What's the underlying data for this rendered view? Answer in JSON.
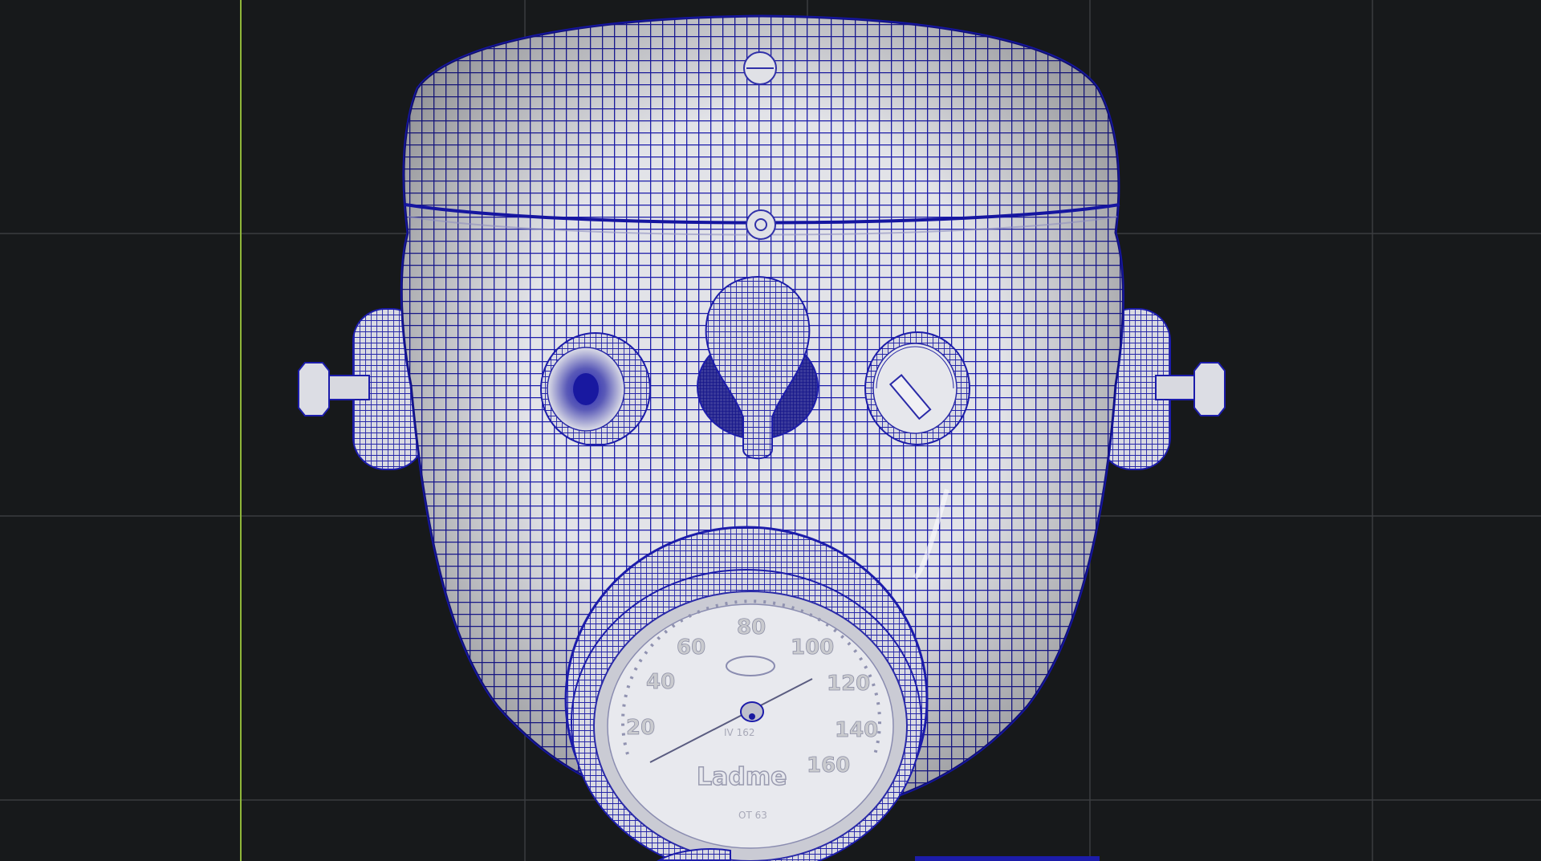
{
  "viewport": {
    "background": "#17191b",
    "grid_color": "#3a3c40",
    "axis_color": "#8fb63a",
    "wire_color": "#1a1aa8",
    "surface_color": "#e4e5ea"
  },
  "model": {
    "name": "robot-head-wireframe",
    "gauge": {
      "numbers": [
        "20",
        "40",
        "60",
        "80",
        "100",
        "120",
        "140",
        "160"
      ],
      "brand": "Ladme",
      "small_top": "IV 162",
      "small_bottom": "OT 63"
    }
  }
}
